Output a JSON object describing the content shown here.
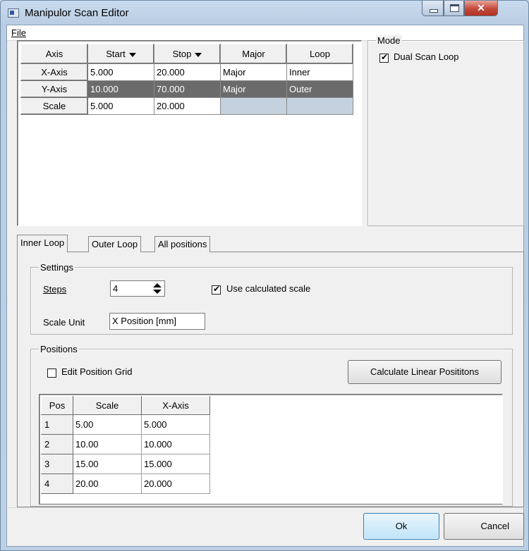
{
  "window": {
    "title": "Manipulor Scan Editor"
  },
  "menu": {
    "file_label": "File"
  },
  "axis_grid": {
    "headers": [
      "Axis",
      "Start",
      "Stop",
      "Major",
      "Loop"
    ],
    "rows": [
      {
        "axis": "X-Axis",
        "start": "5.000",
        "stop": "20.000",
        "major": "Major",
        "loop": "Inner"
      },
      {
        "axis": "Y-Axis",
        "start": "10.000",
        "stop": "70.000",
        "major": "Major",
        "loop": "Outer"
      },
      {
        "axis": "Scale",
        "start": "5.000",
        "stop": "20.000",
        "major": "",
        "loop": ""
      }
    ]
  },
  "mode": {
    "legend": "Mode",
    "dual_scan_loop": "Dual Scan Loop",
    "dual_checked": true
  },
  "tabs": [
    "Inner Loop",
    "Outer Loop",
    "All positions"
  ],
  "settings": {
    "legend": "Settings",
    "steps_label": "Steps",
    "steps_value": "4",
    "use_calc_scale_label": "Use calculated scale",
    "use_calc_checked": true,
    "scale_unit_label": "Scale Unit",
    "scale_unit_value": "X Position [mm]"
  },
  "positions": {
    "legend": "Positions",
    "edit_grid_label": "Edit Position Grid",
    "edit_grid_checked": false,
    "calc_button": "Calculate Linear Posititons",
    "headers": [
      "Pos",
      "Scale",
      "X-Axis"
    ],
    "rows": [
      {
        "pos": "1",
        "scale": "5.00",
        "x": "5.000"
      },
      {
        "pos": "2",
        "scale": "10.00",
        "x": "10.000"
      },
      {
        "pos": "3",
        "scale": "15.00",
        "x": "15.000"
      },
      {
        "pos": "4",
        "scale": "20.00",
        "x": "20.000"
      }
    ]
  },
  "buttons": {
    "ok": "Ok",
    "cancel": "Cancel"
  }
}
